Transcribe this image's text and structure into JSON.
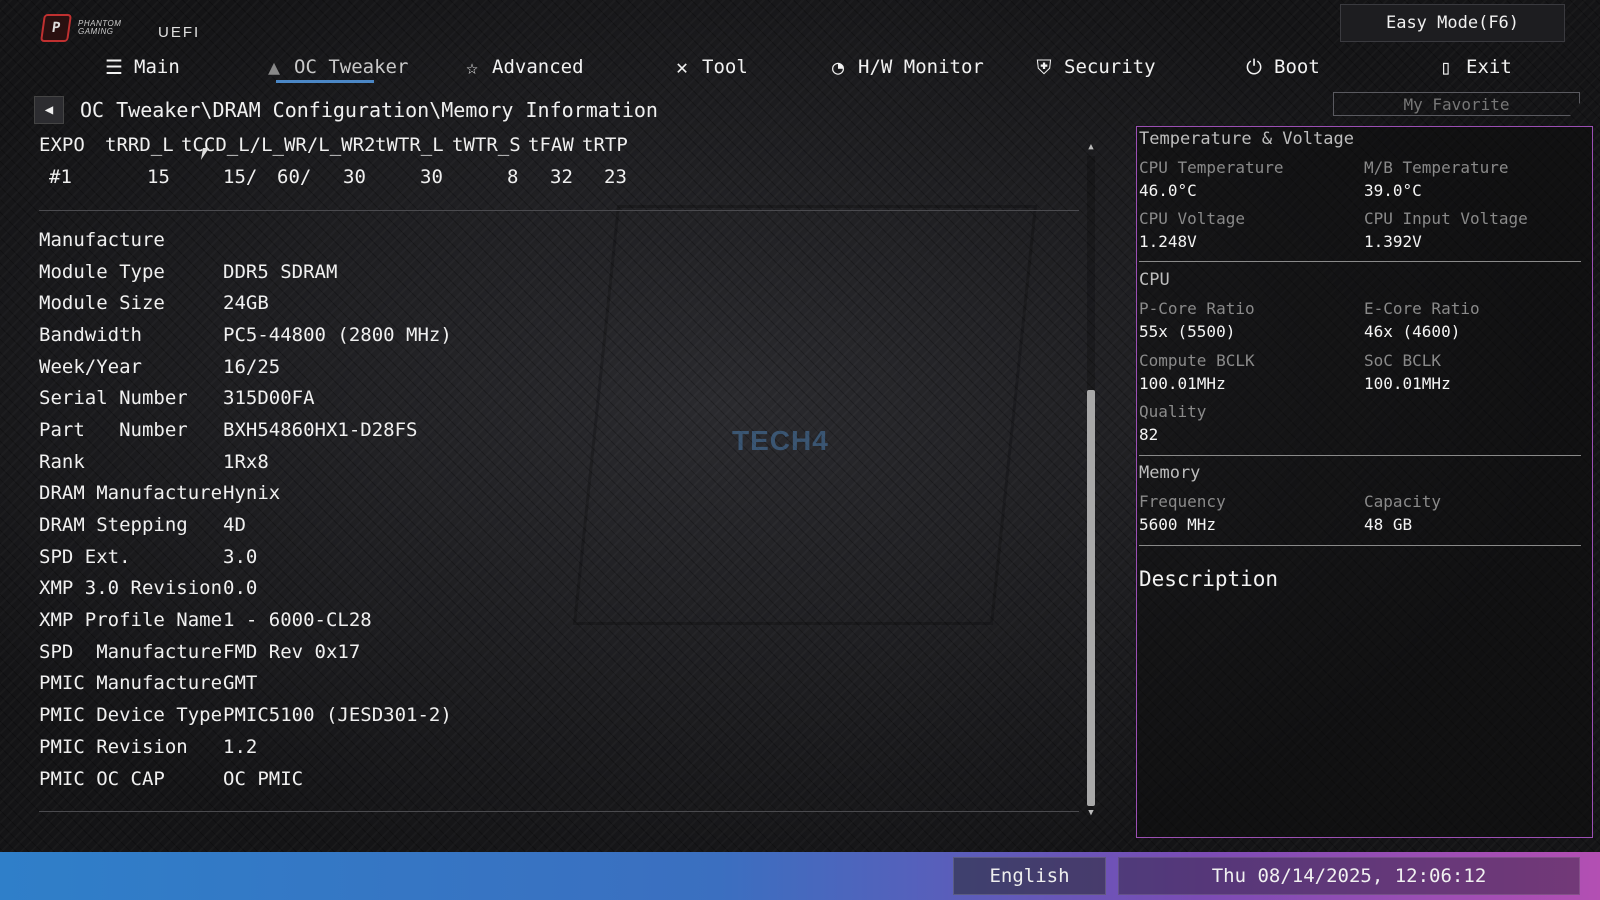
{
  "header": {
    "logo_text_1": "PHANTOM",
    "logo_text_2": "GAMING",
    "uefi_label": "UEFI",
    "easy_mode_label": "Easy Mode(F6)",
    "favorite_label": "My Favorite"
  },
  "tabs": [
    {
      "label": "Main",
      "icon": "main-menu-icon"
    },
    {
      "label": "OC Tweaker",
      "icon": "rocket-icon"
    },
    {
      "label": "Advanced",
      "icon": "star-icon"
    },
    {
      "label": "Tool",
      "icon": "wrench-icon"
    },
    {
      "label": "H/W Monitor",
      "icon": "gauge-icon"
    },
    {
      "label": "Security",
      "icon": "shield-icon"
    },
    {
      "label": "Boot",
      "icon": "power-icon"
    },
    {
      "label": "Exit",
      "icon": "exit-door-icon"
    }
  ],
  "active_tab": "OC Tweaker",
  "breadcrumb": "OC Tweaker\\DRAM Configuration\\Memory Information",
  "timing": {
    "headers": [
      "EXPO",
      "tRRD_L",
      "tCCD_L/L_WR/L_WR2",
      "tWTR_L",
      "tWTR_S",
      "tFAW",
      "tRTP"
    ],
    "row": {
      "profile": "#1",
      "trrd_l": "15",
      "tccd_l": "15/",
      "l_wr": "60/",
      "l_wr2": "30",
      "twtr_l": "30",
      "twtr_s": "8",
      "tfaw": "32",
      "trtp": "23"
    }
  },
  "memory_info": [
    {
      "label": "Manufacture",
      "value": ""
    },
    {
      "label": "Module Type",
      "value": "DDR5 SDRAM"
    },
    {
      "label": "Module Size",
      "value": "24GB"
    },
    {
      "label": "Bandwidth",
      "value": "PC5-44800 (2800 MHz)"
    },
    {
      "label": "Week/Year",
      "value": "16/25"
    },
    {
      "label": "Serial Number",
      "value": "315D00FA"
    },
    {
      "label": "Part   Number",
      "value": "BXH54860HX1-D28FS"
    },
    {
      "label": "Rank",
      "value": "1Rx8"
    },
    {
      "label": "DRAM Manufacture",
      "value": "Hynix"
    },
    {
      "label": "DRAM Stepping",
      "value": "4D"
    },
    {
      "label": "SPD Ext.",
      "value": "3.0"
    },
    {
      "label": "XMP 3.0 Revision",
      "value": "0.0"
    },
    {
      "label": "XMP Profile Name",
      "value": "1 - 6000-CL28"
    },
    {
      "label": "SPD  Manufacture",
      "value": "FMD Rev 0x17"
    },
    {
      "label": "PMIC Manufacture",
      "value": "GMT"
    },
    {
      "label": "PMIC Device Type",
      "value": "PMIC5100 (JESD301-2)"
    },
    {
      "label": "PMIC Revision",
      "value": "1.2"
    },
    {
      "label": "PMIC OC CAP",
      "value": "OC PMIC"
    }
  ],
  "watermark": "TECH4",
  "panel": {
    "temp_voltage": {
      "title": "Temperature & Voltage",
      "cpu_temp_label": "CPU Temperature",
      "cpu_temp_value": "46.0°C",
      "mb_temp_label": "M/B Temperature",
      "mb_temp_value": "39.0°C",
      "cpu_volt_label": "CPU Voltage",
      "cpu_volt_value": "1.248V",
      "cpu_input_label": "CPU Input Voltage",
      "cpu_input_value": "1.392V"
    },
    "cpu": {
      "title": "CPU",
      "pcore_label": "P-Core Ratio",
      "pcore_value": "55x (5500)",
      "ecore_label": "E-Core Ratio",
      "ecore_value": "46x (4600)",
      "compute_bclk_label": "Compute BCLK",
      "compute_bclk_value": "100.01MHz",
      "soc_bclk_label": "SoC BCLK",
      "soc_bclk_value": "100.01MHz",
      "quality_label": "Quality",
      "quality_value": "82"
    },
    "memory": {
      "title": "Memory",
      "freq_label": "Frequency",
      "freq_value": "5600 MHz",
      "cap_label": "Capacity",
      "cap_value": "48 GB"
    },
    "description_label": "Description"
  },
  "footer": {
    "language": "English",
    "datetime": "Thu 08/14/2025, 12:06:12"
  },
  "colors": {
    "panel_border": "#9b4fb4",
    "tab_underline": "#4b87c6",
    "footer_left": "#2f7fc9",
    "footer_right": "#b34fb3"
  }
}
